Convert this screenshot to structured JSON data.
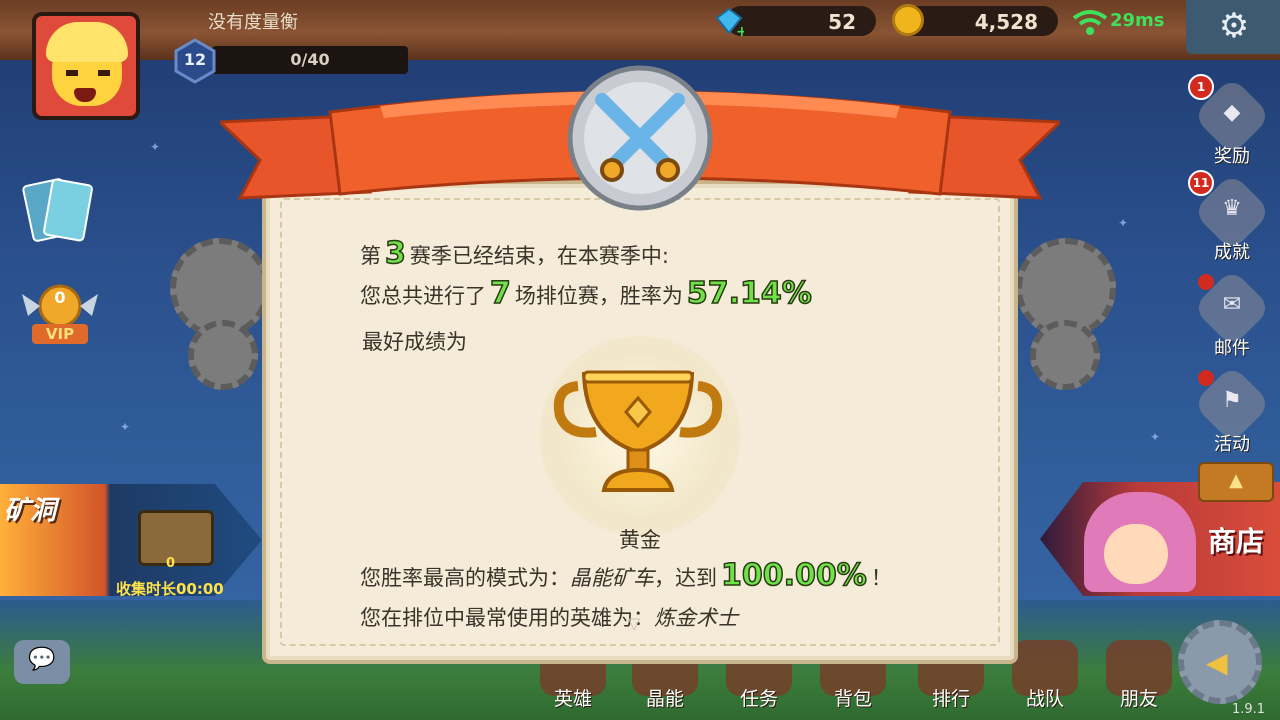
{
  "player": {
    "name": "没有度量衡",
    "level": "12",
    "exp": "0/40"
  },
  "resources": {
    "gems": "52",
    "gold": "4,528",
    "ping": "29ms"
  },
  "left_panel": {
    "vip_level": "0",
    "vip_label": "VIP",
    "mine_title": "矿洞",
    "mine_count": "0",
    "mine_collect": "收集时长00:00"
  },
  "side_menu": [
    {
      "label": "奖励",
      "badge": "1",
      "icon": "reward-bag-icon"
    },
    {
      "label": "成就",
      "badge": "11",
      "icon": "trophy-icon"
    },
    {
      "label": "邮件",
      "badge": "",
      "icon": "mail-icon"
    },
    {
      "label": "活动",
      "badge": "",
      "icon": "flag-icon"
    }
  ],
  "shop": {
    "label": "商店"
  },
  "bottom_nav": [
    {
      "label": "英雄"
    },
    {
      "label": "晶能"
    },
    {
      "label": "任务"
    },
    {
      "label": "背包"
    },
    {
      "label": "排行"
    },
    {
      "label": "战队"
    },
    {
      "label": "朋友"
    }
  ],
  "version": "1.9.1",
  "season_summary": {
    "line1_pre": "第",
    "season_number": "3",
    "line1_post": "赛季已经结束，在本赛季中:",
    "line2_pre": "您总共进行了",
    "matches": "7",
    "line2_mid": "场排位赛，胜率为",
    "win_rate": "57.14%",
    "line3": "最好成绩为",
    "best_rank": "黄金",
    "line4_pre": "您胜率最高的模式为：",
    "best_mode": "晶能矿车",
    "line4_mid": "，达到",
    "best_mode_rate": "100.00%",
    "line4_post": "！",
    "line5_pre": "您在排位中最常使用的英雄为：",
    "most_used_hero": "炼金术士"
  },
  "colors": {
    "highlight": "#6fe14a",
    "ribbon": "#f0602a",
    "parchment": "#f4ecd8",
    "gold_trophy": "#f2a81d"
  }
}
